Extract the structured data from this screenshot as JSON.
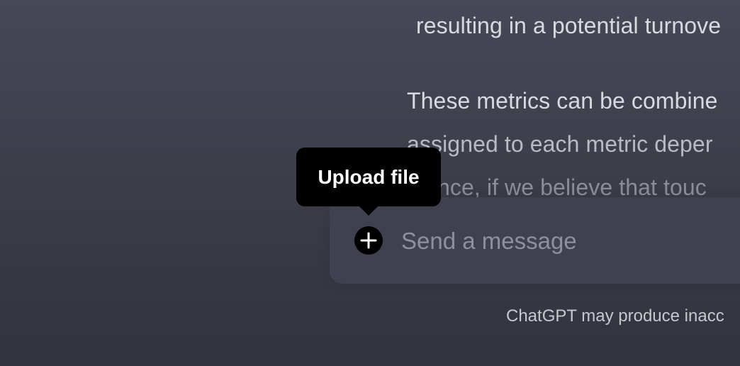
{
  "conversation": {
    "lines": [
      "resulting in a potential turnove",
      "These metrics can be combine",
      "assigned to each metric deper",
      "stance, if we believe that touc"
    ]
  },
  "composer": {
    "placeholder": "Send a message",
    "upload_icon": "plus-circle-icon"
  },
  "tooltip": {
    "text": "Upload file"
  },
  "footer": {
    "disclaimer": "ChatGPT may produce inacc"
  },
  "colors": {
    "background_top": "#474856",
    "background_bottom": "#33333d",
    "input_bg": "#40414f",
    "tooltip_bg": "#000000",
    "text": "#d9dae1"
  }
}
